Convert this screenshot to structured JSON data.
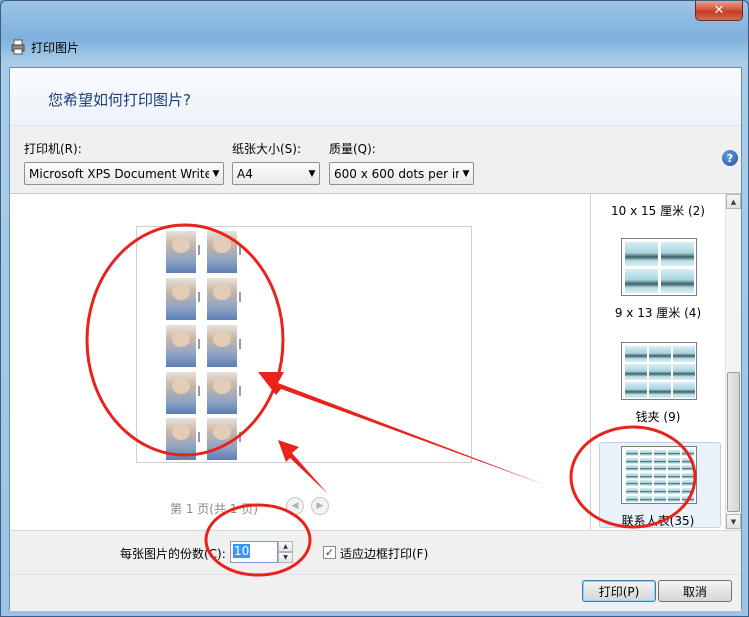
{
  "window": {
    "title": "打印图片",
    "close_label": "✕"
  },
  "header": {
    "question": "您希望如何打印图片?"
  },
  "settings": {
    "printer_label": "打印机(R):",
    "printer_value": "Microsoft XPS Document Write",
    "paper_label": "纸张大小(S):",
    "paper_value": "A4",
    "quality_label": "质量(Q):",
    "quality_value": "600 x 600 dots per ir",
    "help_label": "?"
  },
  "preview": {
    "pager_text": "第 1 页(共 1 页)"
  },
  "layouts": [
    {
      "label": "10 x 15 厘米 (2)"
    },
    {
      "label": "9 x 13 厘米 (4)"
    },
    {
      "label": "钱夹 (9)"
    },
    {
      "label": "联系人表(35)"
    }
  ],
  "copies": {
    "label": "每张图片的份数(C):",
    "value": "10"
  },
  "fit": {
    "label": "适应边框打印(F)",
    "checked": true
  },
  "buttons": {
    "print_label": "打印(P)",
    "cancel_label": "取消"
  },
  "colors": {
    "annotation": "#e8231c"
  }
}
